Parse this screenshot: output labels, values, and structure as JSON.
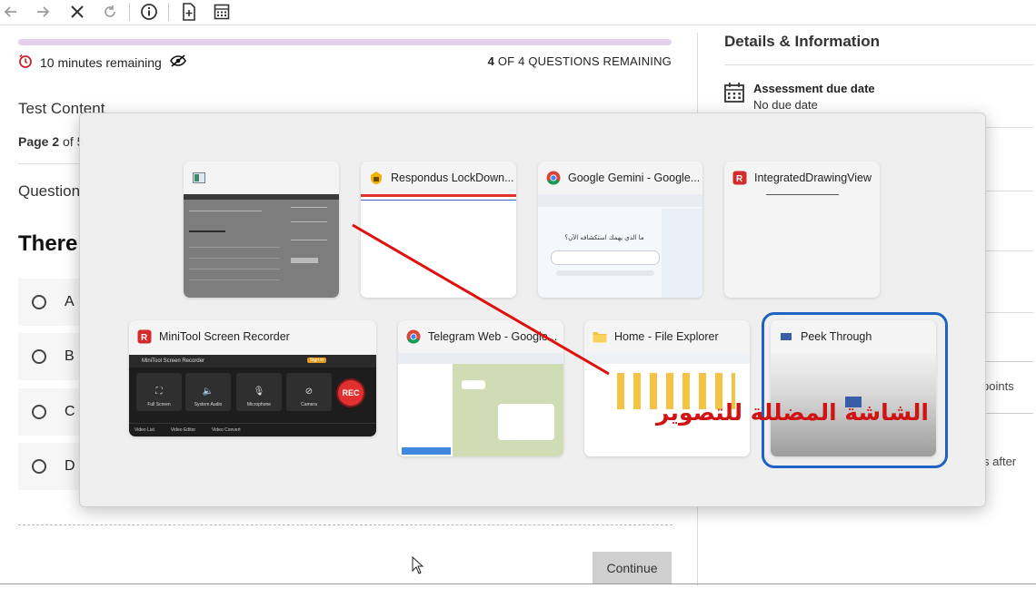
{
  "toolbar": {
    "buttons": [
      "back-arrow-icon",
      "forward-arrow-icon",
      "close-icon",
      "refresh-icon",
      "info-icon",
      "new-page-icon",
      "calculator-icon"
    ]
  },
  "assessment": {
    "progress_pct": 100,
    "time_remaining": "10 minutes remaining",
    "questions_remaining_count": "4",
    "questions_remaining_text": " OF 4 QUESTIONS REMAINING",
    "section_title": "Test Content",
    "page_label": "Page 2",
    "page_of": " of 5",
    "question_label": "Question",
    "question_text": "There",
    "options": [
      "A",
      "B",
      "C",
      "D"
    ],
    "continue_label": "Continue"
  },
  "details": {
    "title": "Details & Information",
    "due_label": "Assessment due date",
    "due_value": "No due date",
    "points_text": "points",
    "after_text": "s after"
  },
  "switcher": {
    "windows": [
      {
        "title": "",
        "icon": "window-icon"
      },
      {
        "title": "Respondus LockDown...",
        "icon": "lockdown-icon"
      },
      {
        "title": "Google Gemini - Google...",
        "icon": "chrome-icon"
      },
      {
        "title": "IntegratedDrawingView",
        "icon": "minitool-icon"
      },
      {
        "title": "MiniTool Screen Recorder",
        "icon": "minitool-icon"
      },
      {
        "title": "Telegram Web - Google...",
        "icon": "chrome-icon"
      },
      {
        "title": "Home - File Explorer",
        "icon": "folder-icon"
      },
      {
        "title": "Peek Through",
        "icon": "window-icon"
      }
    ],
    "selected_window": "Peek Through",
    "recorder": {
      "app_name": "MiniTool Screen Recorder",
      "sign_in": "Sign in",
      "buttons": [
        "Full Screen",
        "System Audio",
        "Microphone",
        "Camera"
      ],
      "rec_label": "REC",
      "footer": [
        "Video List",
        "Video Editor",
        "Video Convert"
      ]
    },
    "gemini_thumb_text": "ما الذي يهمك استكشافه الآن؟",
    "annotation_text": "الشاشة المضللة للتصوير",
    "annotation_color": "#d01414"
  }
}
